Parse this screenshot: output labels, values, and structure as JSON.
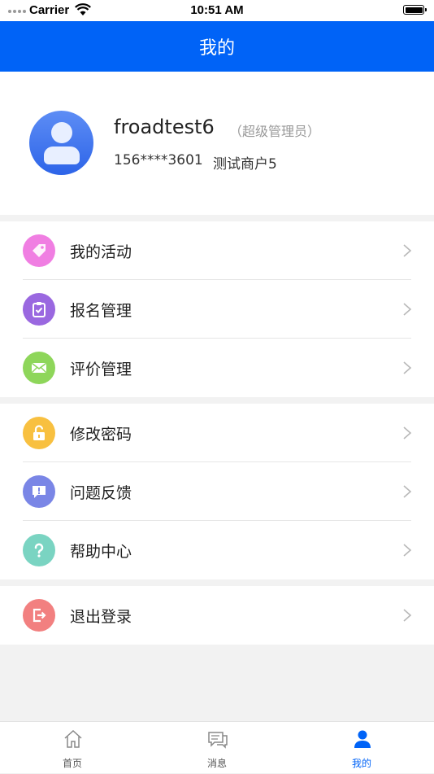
{
  "status_bar": {
    "carrier": "Carrier",
    "time": "10:51 AM"
  },
  "nav": {
    "title": "我的"
  },
  "profile": {
    "username": "froadtest6",
    "role": "（超级管理员）",
    "phone": "156****3601",
    "merchant": "测试商户5"
  },
  "menu": {
    "my_activities": "我的活动",
    "registration_management": "报名管理",
    "review_management": "评价管理",
    "change_password": "修改密码",
    "feedback": "问题反馈",
    "help_center": "帮助中心",
    "logout": "退出登录"
  },
  "tabs": {
    "home": "首页",
    "messages": "消息",
    "mine": "我的"
  },
  "colors": {
    "primary": "#0063f7",
    "activities_icon": "#f07ee2",
    "registration_icon": "#9a68e0",
    "review_icon": "#8ed65a",
    "password_icon": "#f8c040",
    "feedback_icon": "#7a86e6",
    "help_icon": "#7ad4c2",
    "logout_icon": "#f28080"
  }
}
